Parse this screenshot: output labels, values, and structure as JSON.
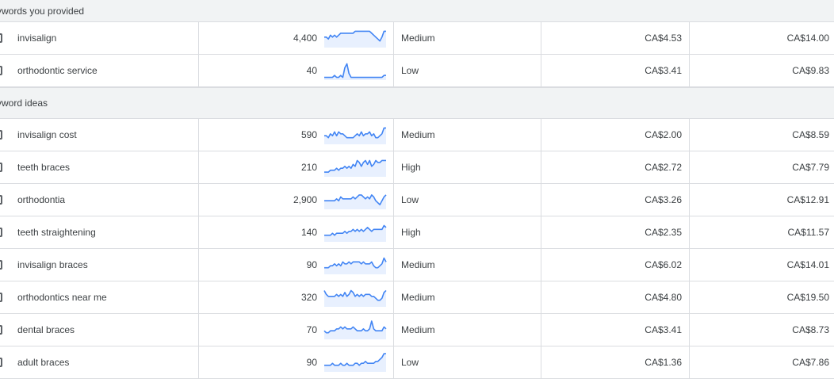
{
  "sections": [
    {
      "title": "ywords you provided",
      "rows": [
        {
          "keyword": "invisalign",
          "searches": "4,400",
          "competition": "Medium",
          "bid_low": "CA$4.53",
          "bid_high": "CA$14.00",
          "trend": [
            5,
            5,
            4,
            6,
            5,
            6,
            5,
            6,
            7,
            7,
            7,
            7,
            7,
            7,
            7,
            8,
            8,
            8,
            8,
            8,
            8,
            8,
            8,
            7,
            6,
            5,
            4,
            3,
            5,
            8,
            8
          ]
        },
        {
          "keyword": "orthodontic service",
          "searches": "40",
          "competition": "Low",
          "bid_low": "CA$3.41",
          "bid_high": "CA$9.83",
          "trend": [
            1,
            1,
            1,
            1,
            1,
            2,
            1,
            1,
            2,
            1,
            6,
            8,
            3,
            1,
            1,
            1,
            1,
            1,
            1,
            1,
            1,
            1,
            1,
            1,
            1,
            1,
            1,
            1,
            1,
            2,
            2
          ]
        }
      ]
    },
    {
      "title": "yword ideas",
      "rows": [
        {
          "keyword": "invisalign cost",
          "searches": "590",
          "competition": "Medium",
          "bid_low": "CA$2.00",
          "bid_high": "CA$8.59",
          "trend": [
            4,
            4,
            3,
            5,
            4,
            6,
            4,
            6,
            5,
            5,
            4,
            3,
            3,
            3,
            3,
            4,
            5,
            4,
            6,
            4,
            5,
            5,
            6,
            4,
            5,
            3,
            3,
            4,
            5,
            8,
            8
          ]
        },
        {
          "keyword": "teeth braces",
          "searches": "210",
          "competition": "High",
          "bid_low": "CA$2.72",
          "bid_high": "CA$7.79",
          "trend": [
            2,
            2,
            2,
            3,
            3,
            3,
            4,
            3,
            4,
            4,
            5,
            4,
            5,
            4,
            6,
            5,
            8,
            7,
            5,
            7,
            8,
            6,
            8,
            5,
            6,
            8,
            7,
            7,
            8,
            8,
            8
          ]
        },
        {
          "keyword": "orthodontia",
          "searches": "2,900",
          "competition": "Low",
          "bid_low": "CA$3.26",
          "bid_high": "CA$12.91",
          "trend": [
            4,
            4,
            4,
            4,
            4,
            4,
            5,
            4,
            6,
            5,
            5,
            5,
            5,
            5,
            6,
            5,
            6,
            7,
            7,
            6,
            5,
            6,
            5,
            7,
            6,
            4,
            3,
            2,
            4,
            6,
            7
          ]
        },
        {
          "keyword": "teeth straightening",
          "searches": "140",
          "competition": "High",
          "bid_low": "CA$2.35",
          "bid_high": "CA$11.57",
          "trend": [
            3,
            3,
            3,
            3,
            4,
            3,
            4,
            4,
            4,
            4,
            5,
            4,
            5,
            5,
            6,
            5,
            6,
            5,
            6,
            5,
            6,
            7,
            6,
            5,
            6,
            6,
            6,
            6,
            6,
            8,
            7
          ]
        },
        {
          "keyword": "invisalign braces",
          "searches": "90",
          "competition": "Medium",
          "bid_low": "CA$6.02",
          "bid_high": "CA$14.01",
          "trend": [
            3,
            3,
            3,
            4,
            4,
            5,
            4,
            5,
            4,
            6,
            5,
            5,
            6,
            5,
            6,
            6,
            6,
            6,
            5,
            6,
            5,
            5,
            5,
            6,
            4,
            3,
            3,
            4,
            5,
            8,
            6
          ]
        },
        {
          "keyword": "orthodontics near me",
          "searches": "320",
          "competition": "Medium",
          "bid_low": "CA$4.80",
          "bid_high": "CA$19.50",
          "trend": [
            8,
            6,
            5,
            5,
            5,
            5,
            6,
            5,
            6,
            5,
            7,
            5,
            6,
            8,
            7,
            5,
            6,
            5,
            6,
            5,
            6,
            6,
            6,
            5,
            5,
            4,
            3,
            3,
            4,
            7,
            8
          ]
        },
        {
          "keyword": "dental braces",
          "searches": "70",
          "competition": "Medium",
          "bid_low": "CA$3.41",
          "bid_high": "CA$8.73",
          "trend": [
            4,
            3,
            3,
            4,
            4,
            4,
            5,
            5,
            6,
            5,
            6,
            5,
            5,
            5,
            6,
            5,
            4,
            4,
            4,
            5,
            4,
            4,
            5,
            9,
            5,
            4,
            4,
            4,
            4,
            6,
            5
          ]
        },
        {
          "keyword": "adult braces",
          "searches": "90",
          "competition": "Low",
          "bid_low": "CA$1.36",
          "bid_high": "CA$7.86",
          "trend": [
            3,
            3,
            3,
            3,
            4,
            3,
            3,
            3,
            4,
            3,
            3,
            4,
            3,
            3,
            3,
            4,
            4,
            3,
            4,
            4,
            5,
            4,
            4,
            4,
            4,
            5,
            5,
            6,
            7,
            9,
            9
          ]
        }
      ]
    }
  ],
  "colors": {
    "spark_line": "#4285f4",
    "spark_fill": "#e8f0fe",
    "section_bg": "#f1f3f4",
    "grid": "#dadce0",
    "text": "#3c4043"
  },
  "icons": {
    "row_checkbox": "checkbox-icon"
  }
}
